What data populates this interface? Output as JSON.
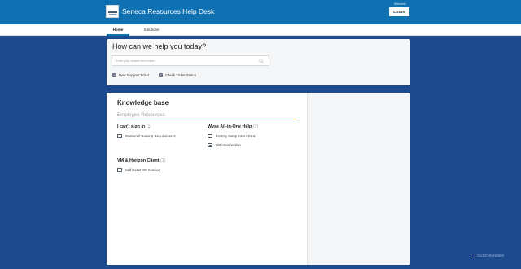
{
  "header": {
    "brand": "Seneca Resources Help Desk",
    "welcome": "Welcome",
    "login_label": "LOGIN",
    "accent_color": "#0f70b2"
  },
  "nav": {
    "tabs": [
      {
        "label": "Home",
        "active": true
      },
      {
        "label": "Solutions",
        "active": false
      }
    ]
  },
  "help": {
    "title": "How can we help you today?",
    "search_placeholder": "Enter your search term here...",
    "actions": [
      {
        "label": "New Support Ticket",
        "icon": "plus-icon"
      },
      {
        "label": "Check Ticket Status",
        "icon": "ticket-status-icon"
      }
    ]
  },
  "knowledge_base": {
    "title": "Knowledge base",
    "category": "Employee Resources",
    "folders": [
      {
        "title": "I can't sign in",
        "count": "(1)",
        "articles": [
          "Password Reset & Requirements"
        ]
      },
      {
        "title": "Wyse All-in-One Help",
        "count": "(2)",
        "articles": [
          "Factory Setup Instructions",
          "WiFi Connection"
        ]
      },
      {
        "title": "VM & Horizon Client",
        "count": "(1)",
        "articles": [
          "Self Reset VM Session"
        ]
      }
    ]
  },
  "watermark": "ScanMalware"
}
